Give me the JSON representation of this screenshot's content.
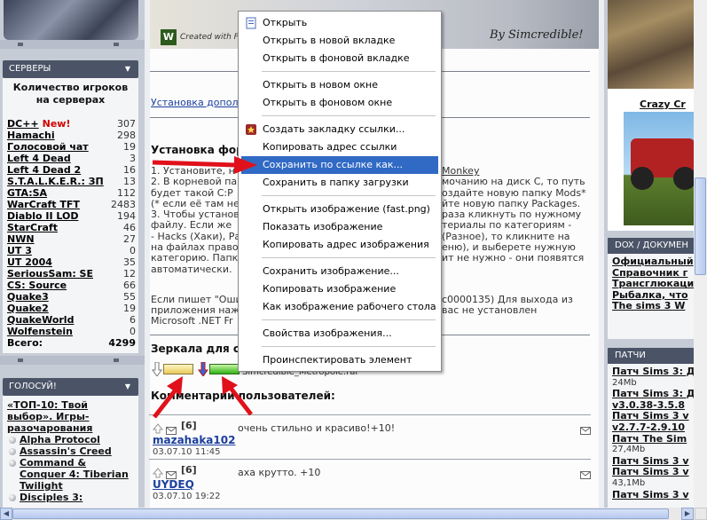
{
  "left": {
    "servers_header": "СЕРВЕРЫ",
    "servers_title": "Количество игроков на серверах",
    "servers": [
      {
        "name": "DC++",
        "badge": "New!",
        "count": "307"
      },
      {
        "name": "Hamachi",
        "badge": "",
        "count": "298"
      },
      {
        "name": "Голосовой чат",
        "badge": "",
        "count": "19"
      },
      {
        "name": "Left 4 Dead",
        "badge": "",
        "count": "3"
      },
      {
        "name": "Left 4 Dead 2",
        "badge": "",
        "count": "16"
      },
      {
        "name": "S.T.A.L.K.E.R.: ЗП",
        "badge": "",
        "count": "13"
      },
      {
        "name": "GTA:SA",
        "badge": "",
        "count": "112"
      },
      {
        "name": "WarCraft TFT",
        "badge": "",
        "count": "2483"
      },
      {
        "name": "Diablo II LOD",
        "badge": "",
        "count": "194"
      },
      {
        "name": "StarCraft",
        "badge": "",
        "count": "46"
      },
      {
        "name": "NWN",
        "badge": "",
        "count": "27"
      },
      {
        "name": "UT 3",
        "badge": "",
        "count": "0"
      },
      {
        "name": "UT 2004",
        "badge": "",
        "count": "35"
      },
      {
        "name": "SeriousSam: SE",
        "badge": "",
        "count": "12"
      },
      {
        "name": "CS: Source",
        "badge": "",
        "count": "66"
      },
      {
        "name": "Quake3",
        "badge": "",
        "count": "55"
      },
      {
        "name": "Quake2",
        "badge": "",
        "count": "19"
      },
      {
        "name": "QuakeWorld",
        "badge": "",
        "count": "6"
      },
      {
        "name": "Wolfenstein",
        "badge": "",
        "count": "0"
      }
    ],
    "servers_total_label": "Всего:",
    "servers_total": "4299",
    "vote_header": "ГОЛОСУЙ!",
    "vote_title": "«ТОП-10: Твой выбор». Игры-разочарования",
    "vote_items": [
      "Alpha Protocol",
      "Assassin's Creed",
      "Command & Conquer 4: Tiberian Twilight",
      "Disciples 3:"
    ]
  },
  "center": {
    "banner_logo": "W",
    "banner_text": "Created with P",
    "banner_sign": "By Simcredible!",
    "install_link": "Установка допол",
    "install_heading": "Установка фор",
    "install_paragraph": [
      "1. Установите, н",
      "2. В корневой па",
      "будет такой C:P",
      "(* если её там не",
      "3. Чтобы установ",
      "файлу. Если же",
      "- Hacks (Хаки), Ра",
      "на файлах правой",
      "категорию. Папк",
      "автоматически."
    ],
    "install_paragraph_right": [
      "Monkey",
      "мочанию на диск C, то путь",
      "оздайте новую папку Mods*",
      "йте новую папку Packages.",
      "раза кликнуть по нужному",
      "териалы по категориям -",
      "(Разное), то кликните на",
      "еню), и выберете нужную",
      "ит не нужно - они появятся",
      ""
    ],
    "error_line_1": "Если пишет \"Оши",
    "error_line_1_right": "c0000135) Для выхода из",
    "error_line_2": "приложения наж",
    "error_line_2_right": "вас не установлен",
    "error_line_3": "Microsoft .NET Fr",
    "mirrors_heading": "Зеркала для с",
    "file_name": "Simcredible_Metropole.rar",
    "comments_heading": "Комментарии пользователей:",
    "comments": [
      {
        "count": "[6]",
        "user": "mazahaka102",
        "date": "03.07.10 11:45",
        "text": "очень стильно и красиво!+10!"
      },
      {
        "count": "[6]",
        "user": "UYDEQ",
        "date": "03.07.10 19:22",
        "text": "аха крутто. +10"
      }
    ]
  },
  "right": {
    "game_title": "Crazy Cr",
    "docs_header": "DOX / ДОКУМЕН",
    "docs_items": [
      "Официальный",
      "Справочник г",
      "Трансглюкаци",
      "Рыбалка, что",
      "The sims 3 W"
    ],
    "patches_header": "ПАТЧИ",
    "patches": [
      {
        "name": "Патч Sims 3: Д",
        "size": "24Mb"
      },
      {
        "name": "Патч Sims 3: Д",
        "size": ""
      },
      {
        "name": "v3.0.38-3.5.8",
        "size": ""
      },
      {
        "name": "Патч Sims 3 v",
        "size": ""
      },
      {
        "name": "v2.7.7-2.9.10",
        "size": ""
      },
      {
        "name": "Патч The Sim",
        "size": "27,4Mb"
      },
      {
        "name": "Патч Sims 3 v",
        "size": ""
      },
      {
        "name": "Патч Sims 3 v",
        "size": "43,1Mb"
      },
      {
        "name": "Патч Sims 3 v",
        "size": ""
      }
    ]
  },
  "context_menu": {
    "items": [
      "Открыть",
      "Открыть в новой вкладке",
      "Открыть в фоновой вкладке",
      "---",
      "Открыть в новом окне",
      "Открыть в фоновом окне",
      "---",
      "Создать закладку ссылки...",
      "Копировать адрес ссылки",
      "Сохранить по ссылке как...",
      "Сохранить в папку загрузки",
      "---",
      "Открыть изображение (fast.png)",
      "Показать изображение",
      "Копировать адрес изображения",
      "---",
      "Сохранить изображение...",
      "Копировать изображение",
      "Как изображение рабочего стола",
      "---",
      "Свойства изображения...",
      "---",
      "Проинспектировать элемент"
    ],
    "selected_index": 9,
    "highlight_color": "#316ac5"
  },
  "colors": {
    "annotation": "#e0111a",
    "panel_header": "#4b5467",
    "link": "#1b3f9c"
  }
}
